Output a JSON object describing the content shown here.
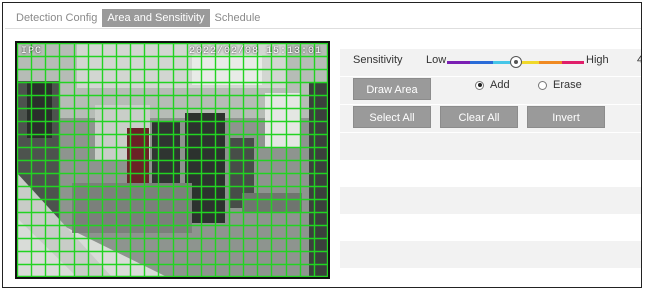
{
  "tabs": [
    {
      "label": "Detection Config",
      "active": false
    },
    {
      "label": "Area and Sensitivity",
      "active": true
    },
    {
      "label": "Schedule",
      "active": false
    }
  ],
  "video": {
    "osd_camera": "IPC",
    "osd_timestamp": "2022/02/08 15:13:01",
    "grid_color": "#22d322",
    "grid_columns": 22,
    "grid_rows": 18,
    "all_cells_selected": true
  },
  "sensitivity": {
    "label": "Sensitivity",
    "low_label": "Low",
    "high_label": "High",
    "value": "4",
    "level_fraction": 0.5,
    "scale_colors": [
      "#7a1fb3",
      "#2a6bd8",
      "#46c6e8",
      "#f0d82a",
      "#f08a22",
      "#e01f6a"
    ]
  },
  "draw_area": {
    "button_label": "Draw Area",
    "mode_add_label": "Add",
    "mode_erase_label": "Erase",
    "selected_mode": "add"
  },
  "actions": {
    "select_all_label": "Select All",
    "clear_all_label": "Clear All",
    "invert_label": "Invert"
  },
  "theme": {
    "button_bg": "#9a9a9a",
    "row_stripe": "#f2f2f2"
  }
}
